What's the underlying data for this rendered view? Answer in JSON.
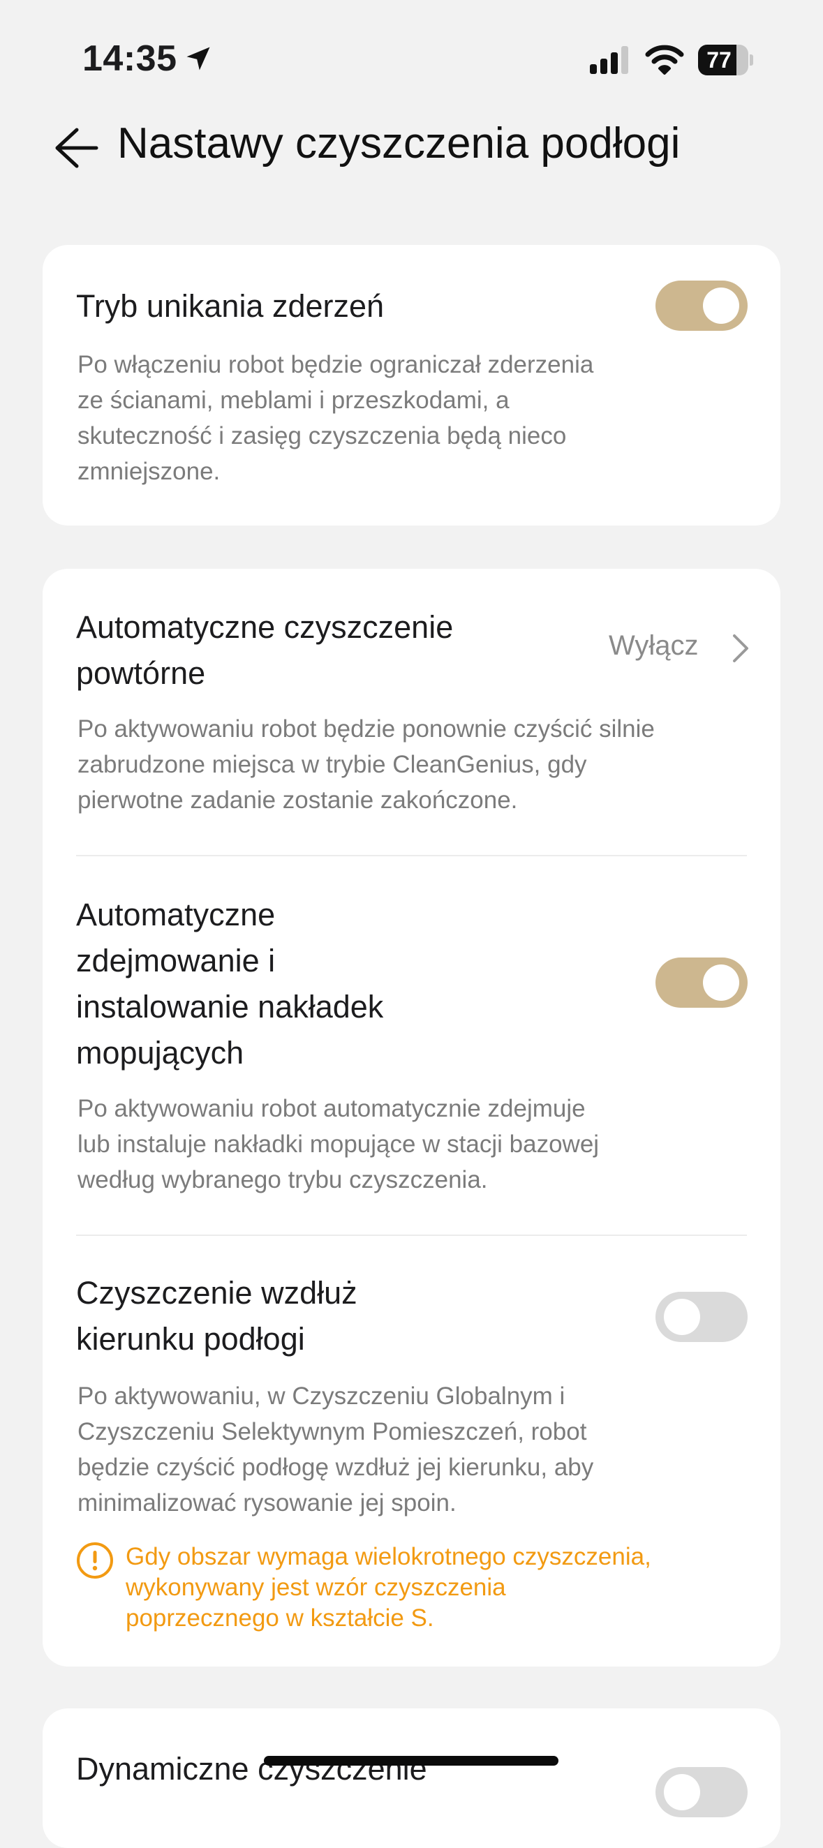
{
  "status_bar": {
    "time": "14:35",
    "battery": "77",
    "battery_level": 0.77
  },
  "header": {
    "title": "Nastawy czyszczenia podłogi"
  },
  "card1": {
    "title": "Tryb unikania zderzeń",
    "toggle_on": true,
    "description": [
      "Po włączeniu robot będzie ograniczał zderzenia",
      "ze ścianami, meblami i przeszkodami, a",
      "skuteczność i zasięg czyszczenia będą nieco",
      "zmniejszone."
    ]
  },
  "card2": {
    "auto_reclean": {
      "title": [
        "Automatyczne czyszczenie",
        "powtórne"
      ],
      "value": "Wyłącz",
      "description": [
        "Po aktywowaniu robot będzie ponownie czyścić silnie",
        "zabrudzone miejsca w trybie CleanGenius, gdy",
        "pierwotne zadanie zostanie zakończone."
      ]
    },
    "mop_pads": {
      "title": [
        "Automatyczne",
        "zdejmowanie i",
        "instalowanie nakładek",
        "mopujących"
      ],
      "toggle_on": true,
      "description": [
        "Po aktywowaniu robot automatycznie zdejmuje",
        "lub instaluje nakładki mopujące w stacji bazowej",
        "według wybranego trybu czyszczenia."
      ]
    },
    "floor_direction": {
      "title": [
        "Czyszczenie wzdłuż",
        "kierunku podłogi"
      ],
      "toggle_on": false,
      "description": [
        "Po aktywowaniu, w Czyszczeniu Globalnym i",
        "Czyszczeniu Selektywnym Pomieszczeń, robot",
        "będzie czyścić podłogę wzdłuż jej kierunku, aby",
        "minimalizować rysowanie jej spoin."
      ],
      "warning": [
        "Gdy obszar wymaga wielokrotnego czyszczenia,",
        "wykonywany jest wzór czyszczenia",
        "poprzecznego w kształcie S."
      ]
    }
  },
  "card3": {
    "title": "Dynamiczne czyszczenie",
    "toggle_on": false
  },
  "colors": {
    "accent": "#cdb78f",
    "warning": "#f29a12",
    "toggle_off": "#dadada"
  }
}
